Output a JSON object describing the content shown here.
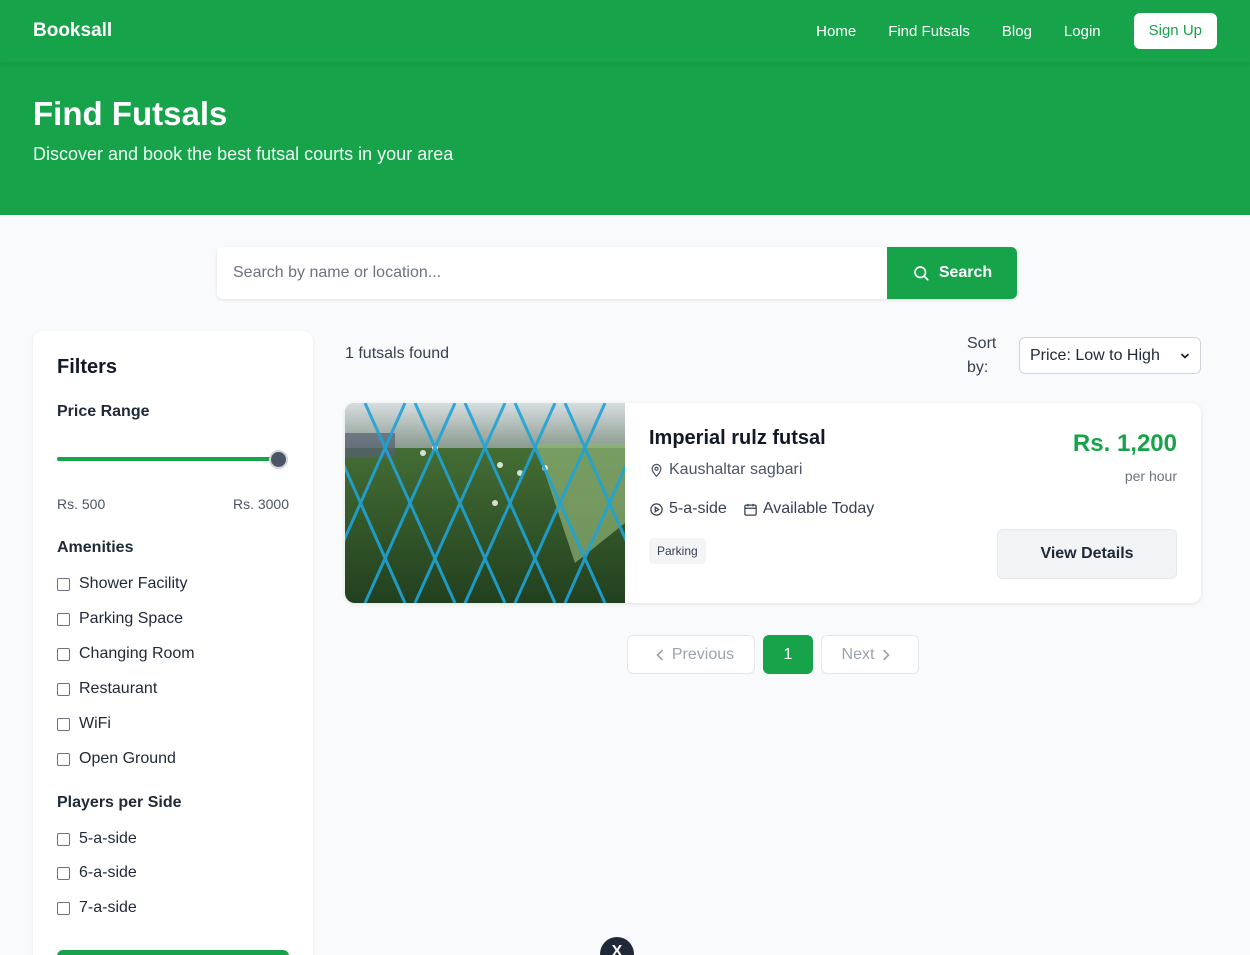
{
  "nav": {
    "brand": "Booksall",
    "links": [
      "Home",
      "Find Futsals",
      "Blog",
      "Login"
    ],
    "signup_label": "Sign Up"
  },
  "hero": {
    "title": "Find Futsals",
    "subtitle": "Discover and book the best futsal courts in your area"
  },
  "search": {
    "placeholder": "Search by name or location...",
    "button_label": "Search"
  },
  "filters": {
    "title": "Filters",
    "price_range": {
      "label": "Price Range",
      "min_label": "Rs. 500",
      "max_label": "Rs. 3000",
      "slider_value_fraction": 1.0
    },
    "amenities": {
      "label": "Amenities",
      "options": [
        "Shower Facility",
        "Parking Space",
        "Changing Room",
        "Restaurant",
        "WiFi",
        "Open Ground"
      ]
    },
    "players": {
      "label": "Players per Side",
      "options": [
        "5-a-side",
        "6-a-side",
        "7-a-side"
      ]
    }
  },
  "results": {
    "count_text": "1 futsals found",
    "sort_label": "Sort by:",
    "sort_value": "Price: Low to High"
  },
  "futsal": {
    "name": "Imperial rulz futsal",
    "location": "Kaushaltar sagbari",
    "size": "5-a-side",
    "availability": "Available Today",
    "tag": "Parking",
    "price": "Rs. 1,200",
    "price_unit": "per hour",
    "cta": "View Details"
  },
  "pagination": {
    "previous": "Previous",
    "current": "1",
    "next": "Next"
  },
  "floating_badge": "X",
  "colors": {
    "brand_green": "#16a34a",
    "page_bg": "#f9fafb"
  }
}
